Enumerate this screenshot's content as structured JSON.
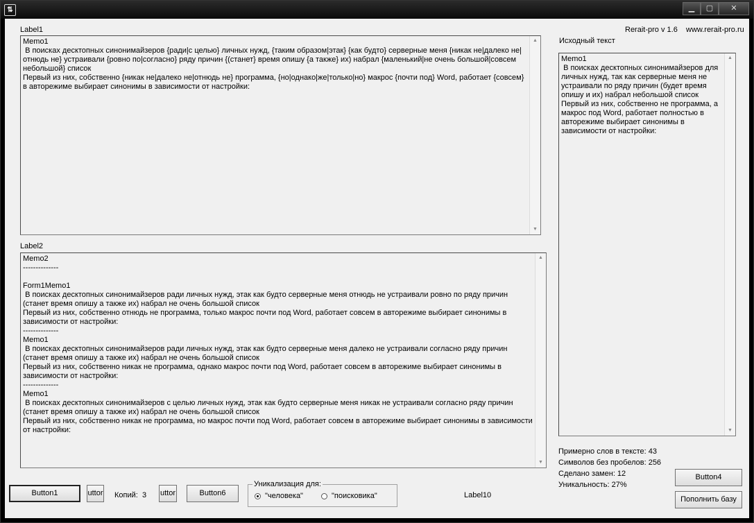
{
  "window": {
    "icon": "app-logo-icon",
    "min": "▁",
    "max": "▢",
    "close": "✕"
  },
  "label1": "Label1",
  "label2": "Label2",
  "memo1_text": "Memo1\n В поисках десктопных синонимайзеров {ради|с целью} личных нужд, {таким образом|этак} {как будто} серверные меня {никак не|далеко не|отнюдь не} устраивали {ровно по|согласно} ряду причин {(станет} время опишу {а также} их) набрал {маленький|не очень большой|совсем небольшой} список\nПервый из них, собственно {никак не|далеко не|отнюдь не} программа, {но|однако|же|только|но} макрос {почти под} Word, работает {совсем} в авторежиме выбирает синонимы в зависимости от настройки:",
  "memo2_text": "Memo2\n--------------\n\nForm1Memo1\n В поисках десктопных синонимайзеров ради личных нужд, этак как будто серверные меня отнюдь не устраивали ровно по ряду причин (станет время опишу а также их) набрал не очень большой список\nПервый из них, собственно отнюдь не программа, только макрос почти под Word, работает совсем в авторежиме выбирает синонимы в зависимости от настройки:\n--------------\nMemo1\n В поисках десктопных синонимайзеров ради личных нужд, этак как будто серверные меня далеко не устраивали согласно ряду причин (станет время опишу а также их) набрал не очень большой список\nПервый из них, собственно никак не программа, однако макрос почти под Word, работает совсем в авторежиме выбирает синонимы в зависимости от настройки:\n--------------\nMemo1\n В поисках десктопных синонимайзеров с целью личных нужд, этак как будто серверные меня никак не устраивали согласно ряду причин (станет время опишу а также их) набрал не очень большой список\nПервый из них, собственно никак не программа, но макрос почти под Word, работает совсем в авторежиме выбирает синонимы в зависимости от настройки:",
  "header": {
    "version": "Rerait-pro v 1.6",
    "site": "www.rerait-pro.ru"
  },
  "source_label": "Исходный текст",
  "memo3_text": "Memo1\n В поисках десктопных синонимайзеров для личных нужд, так как серверные меня не устраивали по ряду причин (будет время опишу и их) набрал небольшой список\nПервый из них, собственно не программа, а макрос под Word, работает полностью в авторежиме выбирает синонимы в зависимости от настройки:",
  "stats": {
    "words": "Примерно слов в тексте: 43",
    "chars": "Символов без пробелов: 256",
    "replacements": "Сделано замен: 12",
    "uniqueness": "Уникальность: 27%"
  },
  "buttons": {
    "button1": "Button1",
    "button_small1": "uttor",
    "copies_label": "Копий:",
    "copies_value": "3",
    "button_small2": "uttor",
    "button6": "Button6",
    "button4": "Button4",
    "fill_db": "Пополнить базу"
  },
  "uniq_group": {
    "legend": "Уникализация для:",
    "options": [
      "\"человека\"",
      "\"поисковика\""
    ],
    "selected": 0
  },
  "label10": "Label10"
}
